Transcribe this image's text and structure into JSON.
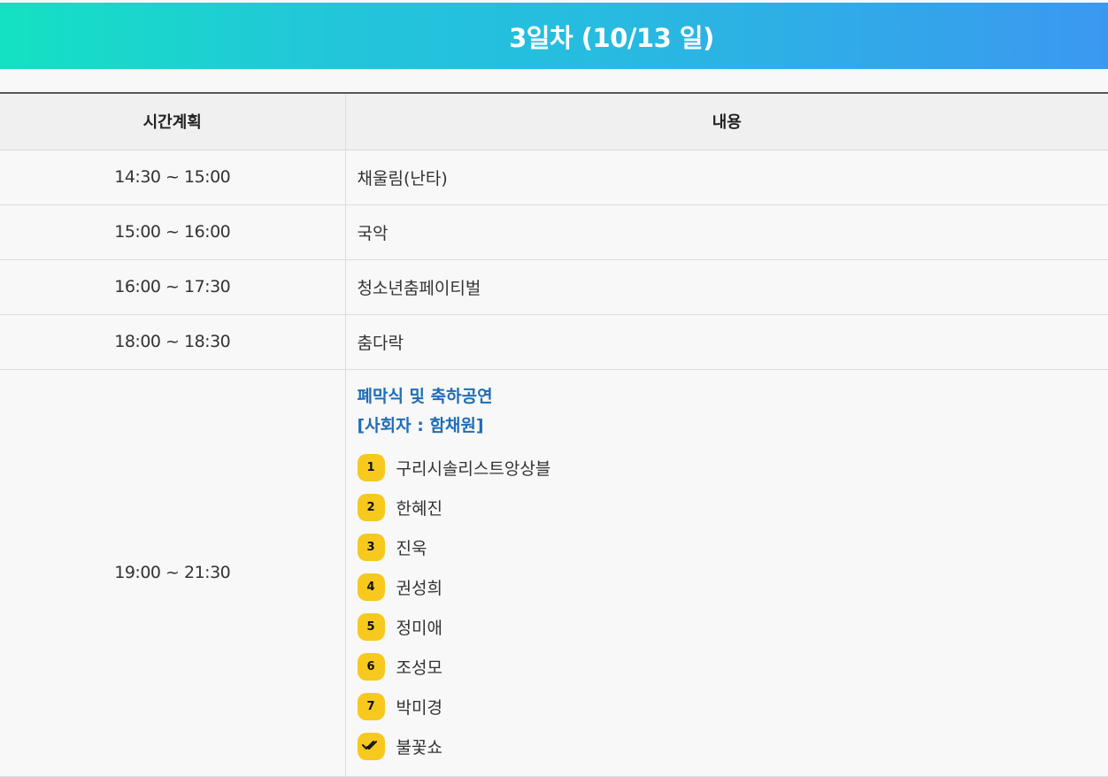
{
  "banner": {
    "title": "3일차 (10/13 일)"
  },
  "table": {
    "headers": {
      "time": "시간계획",
      "content": "내용"
    },
    "rows": [
      {
        "time": "14:30 ~ 15:00",
        "content": "채울림(난타)"
      },
      {
        "time": "15:00 ~ 16:00",
        "content": "국악"
      },
      {
        "time": "16:00 ~ 17:30",
        "content": "청소년춤페이티벌"
      },
      {
        "time": "18:00 ~ 18:30",
        "content": "춤다락"
      }
    ],
    "closing": {
      "time": "19:00 ~ 21:30",
      "title": "폐막식 및 축하공연",
      "host": "[사회자 : 함채원]",
      "performers": [
        {
          "badge": "1",
          "name": "구리시솔리스트앙상블"
        },
        {
          "badge": "2",
          "name": "한혜진"
        },
        {
          "badge": "3",
          "name": "진욱"
        },
        {
          "badge": "4",
          "name": "권성희"
        },
        {
          "badge": "5",
          "name": "정미애"
        },
        {
          "badge": "6",
          "name": "조성모"
        },
        {
          "badge": "7",
          "name": "박미경"
        }
      ],
      "finale": {
        "icon": "double-check-icon",
        "name": "불꽃쇼"
      }
    }
  },
  "colors": {
    "banner_gradient": [
      "#14e1c3",
      "#27bbe0",
      "#3b98f0"
    ],
    "accent_text": "#1f6db5",
    "badge": "#f7c81e"
  }
}
